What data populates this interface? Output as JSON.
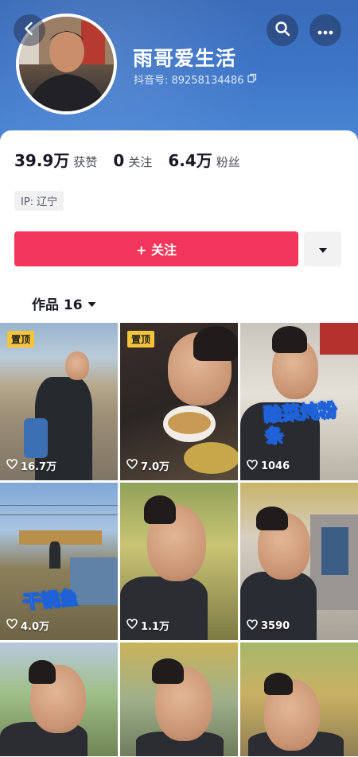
{
  "profile": {
    "nickname": "雨哥爱生活",
    "douyin_id_label": "抖音号: 89258134486"
  },
  "stats": [
    {
      "value": "39.9万",
      "label": "获赞"
    },
    {
      "value": "0",
      "label": "关注"
    },
    {
      "value": "6.4万",
      "label": "粉丝"
    }
  ],
  "ip_tag": "IP: 辽宁",
  "follow_button": "+ 关注",
  "works_tab": "作品 16",
  "colors": {
    "accent": "#f2355a",
    "pin_badge": "#f5c43b",
    "header_blue": "#3d74c6"
  },
  "videos": [
    {
      "likes": "16.7万",
      "pinned_label": "置顶",
      "caption": ""
    },
    {
      "likes": "7.0万",
      "pinned_label": "置顶",
      "caption": ""
    },
    {
      "likes": "1046",
      "pinned_label": "",
      "caption": "酸菜炖粉条"
    },
    {
      "likes": "4.0万",
      "pinned_label": "",
      "caption": "干锅鱼"
    },
    {
      "likes": "1.1万",
      "pinned_label": "",
      "caption": ""
    },
    {
      "likes": "3590",
      "pinned_label": "",
      "caption": ""
    },
    {
      "likes": "",
      "pinned_label": "",
      "caption": ""
    },
    {
      "likes": "",
      "pinned_label": "",
      "caption": ""
    },
    {
      "likes": "",
      "pinned_label": "",
      "caption": ""
    }
  ],
  "icons": [
    "back-arrow-icon",
    "search-icon",
    "more-dots-icon",
    "copy-icon",
    "plus-icon",
    "chevron-down-icon",
    "heart-outline-icon"
  ]
}
